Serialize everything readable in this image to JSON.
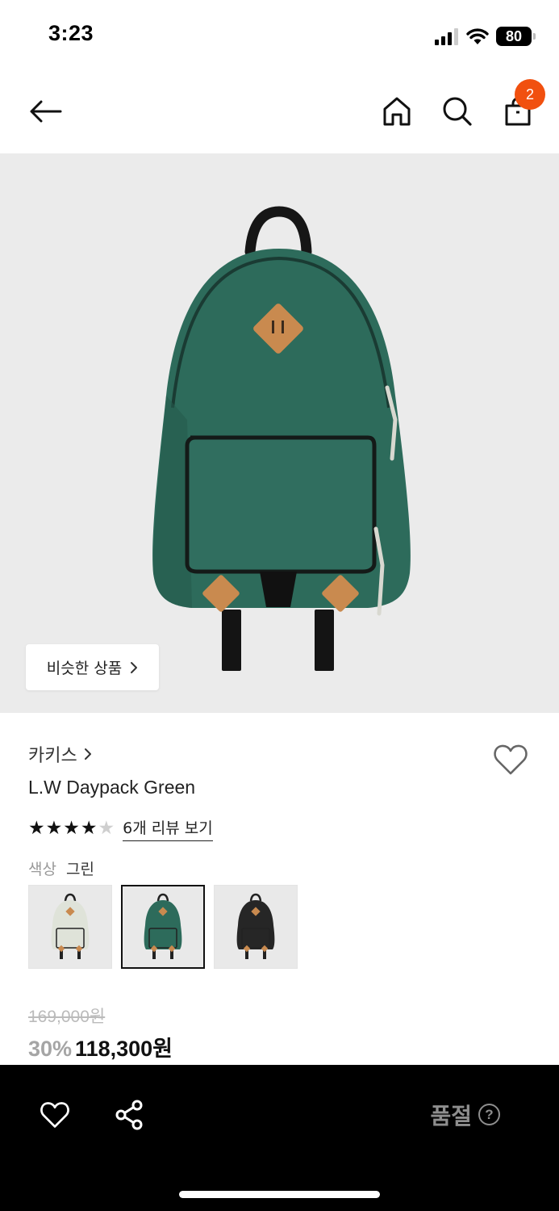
{
  "status_bar": {
    "time": "3:23",
    "battery": "80",
    "icons": [
      "signal-icon",
      "wifi-icon",
      "battery-icon"
    ]
  },
  "nav": {
    "icons": [
      "back-arrow-icon",
      "home-icon",
      "search-icon",
      "shopping-bag-icon"
    ],
    "cart_count": "2"
  },
  "product": {
    "image_bg": "#ebebeb",
    "bag_color": "#2d6b5b",
    "similar_label": "비슷한 상품",
    "brand": "카키스",
    "name": "L.W Daypack Green",
    "rating": 4,
    "rating_max": 5,
    "review_link": "6개 리뷰 보기",
    "color_label": "색상",
    "color_value": "그린",
    "swatches": [
      {
        "name": "mint",
        "color": "#dfe3d9"
      },
      {
        "name": "green",
        "color": "#2d6b5b",
        "selected": true
      },
      {
        "name": "black",
        "color": "#262626"
      }
    ],
    "original_price": "169,000원",
    "discount": "30%",
    "sale_price": "118,300원"
  },
  "bottom_bar": {
    "status": "품절",
    "help": "?",
    "icons": [
      "heart-icon",
      "share-icon"
    ]
  },
  "colors": {
    "accent": "#f1500f",
    "bottom_bar_bg": "#000000",
    "soldout_text": "#8e8e8e"
  }
}
